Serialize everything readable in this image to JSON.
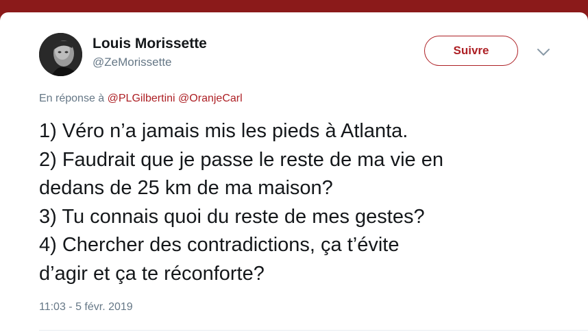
{
  "author": {
    "name": "Louis Morissette",
    "handle": "@ZeMorissette"
  },
  "follow_label": "Suivre",
  "reply": {
    "prefix": "En réponse à",
    "mentions": [
      "@PLGilbertini",
      "@OranjeCarl"
    ]
  },
  "tweet": {
    "lines": [
      "1) Véro n’a jamais mis les pieds à Atlanta.",
      "2) Faudrait que je passe le reste de ma vie en",
      "dedans de 25 km de ma maison?",
      "3) Tu connais quoi du reste de mes gestes?",
      "4) Chercher des contradictions, ça t’évite",
      "d’agir et ça te réconforte?"
    ]
  },
  "timestamp": "11:03 - 5 févr. 2019",
  "colors": {
    "accent": "#ad1f24",
    "text": "#14171a",
    "secondary": "#657786",
    "background_frame": "#8b1a1a"
  },
  "icons": {
    "menu": "chevron-down-icon"
  }
}
